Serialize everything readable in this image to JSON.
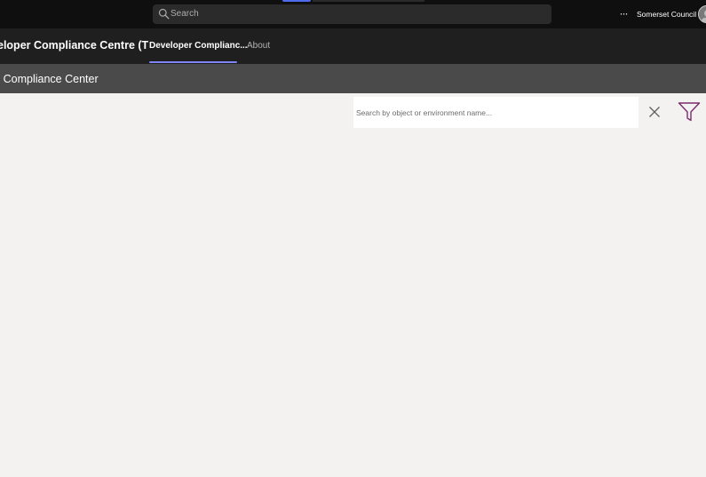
{
  "topbar": {
    "search_placeholder": "Search",
    "more_label": "···",
    "org_name": "Somerset Council"
  },
  "app": {
    "title": "eloper Compliance Centre (T",
    "tabs": [
      {
        "label": "Developer Complianc..."
      },
      {
        "label": "About"
      }
    ]
  },
  "header": {
    "title": "r Compliance Center"
  },
  "filter": {
    "search_placeholder": "Search by object or environment name..."
  },
  "colors": {
    "tab_underline": "#7f85f5",
    "filter_icon": "#7b2b6e"
  },
  "icons": [
    "search-icon",
    "more-icon",
    "close-icon",
    "filter-icon"
  ]
}
